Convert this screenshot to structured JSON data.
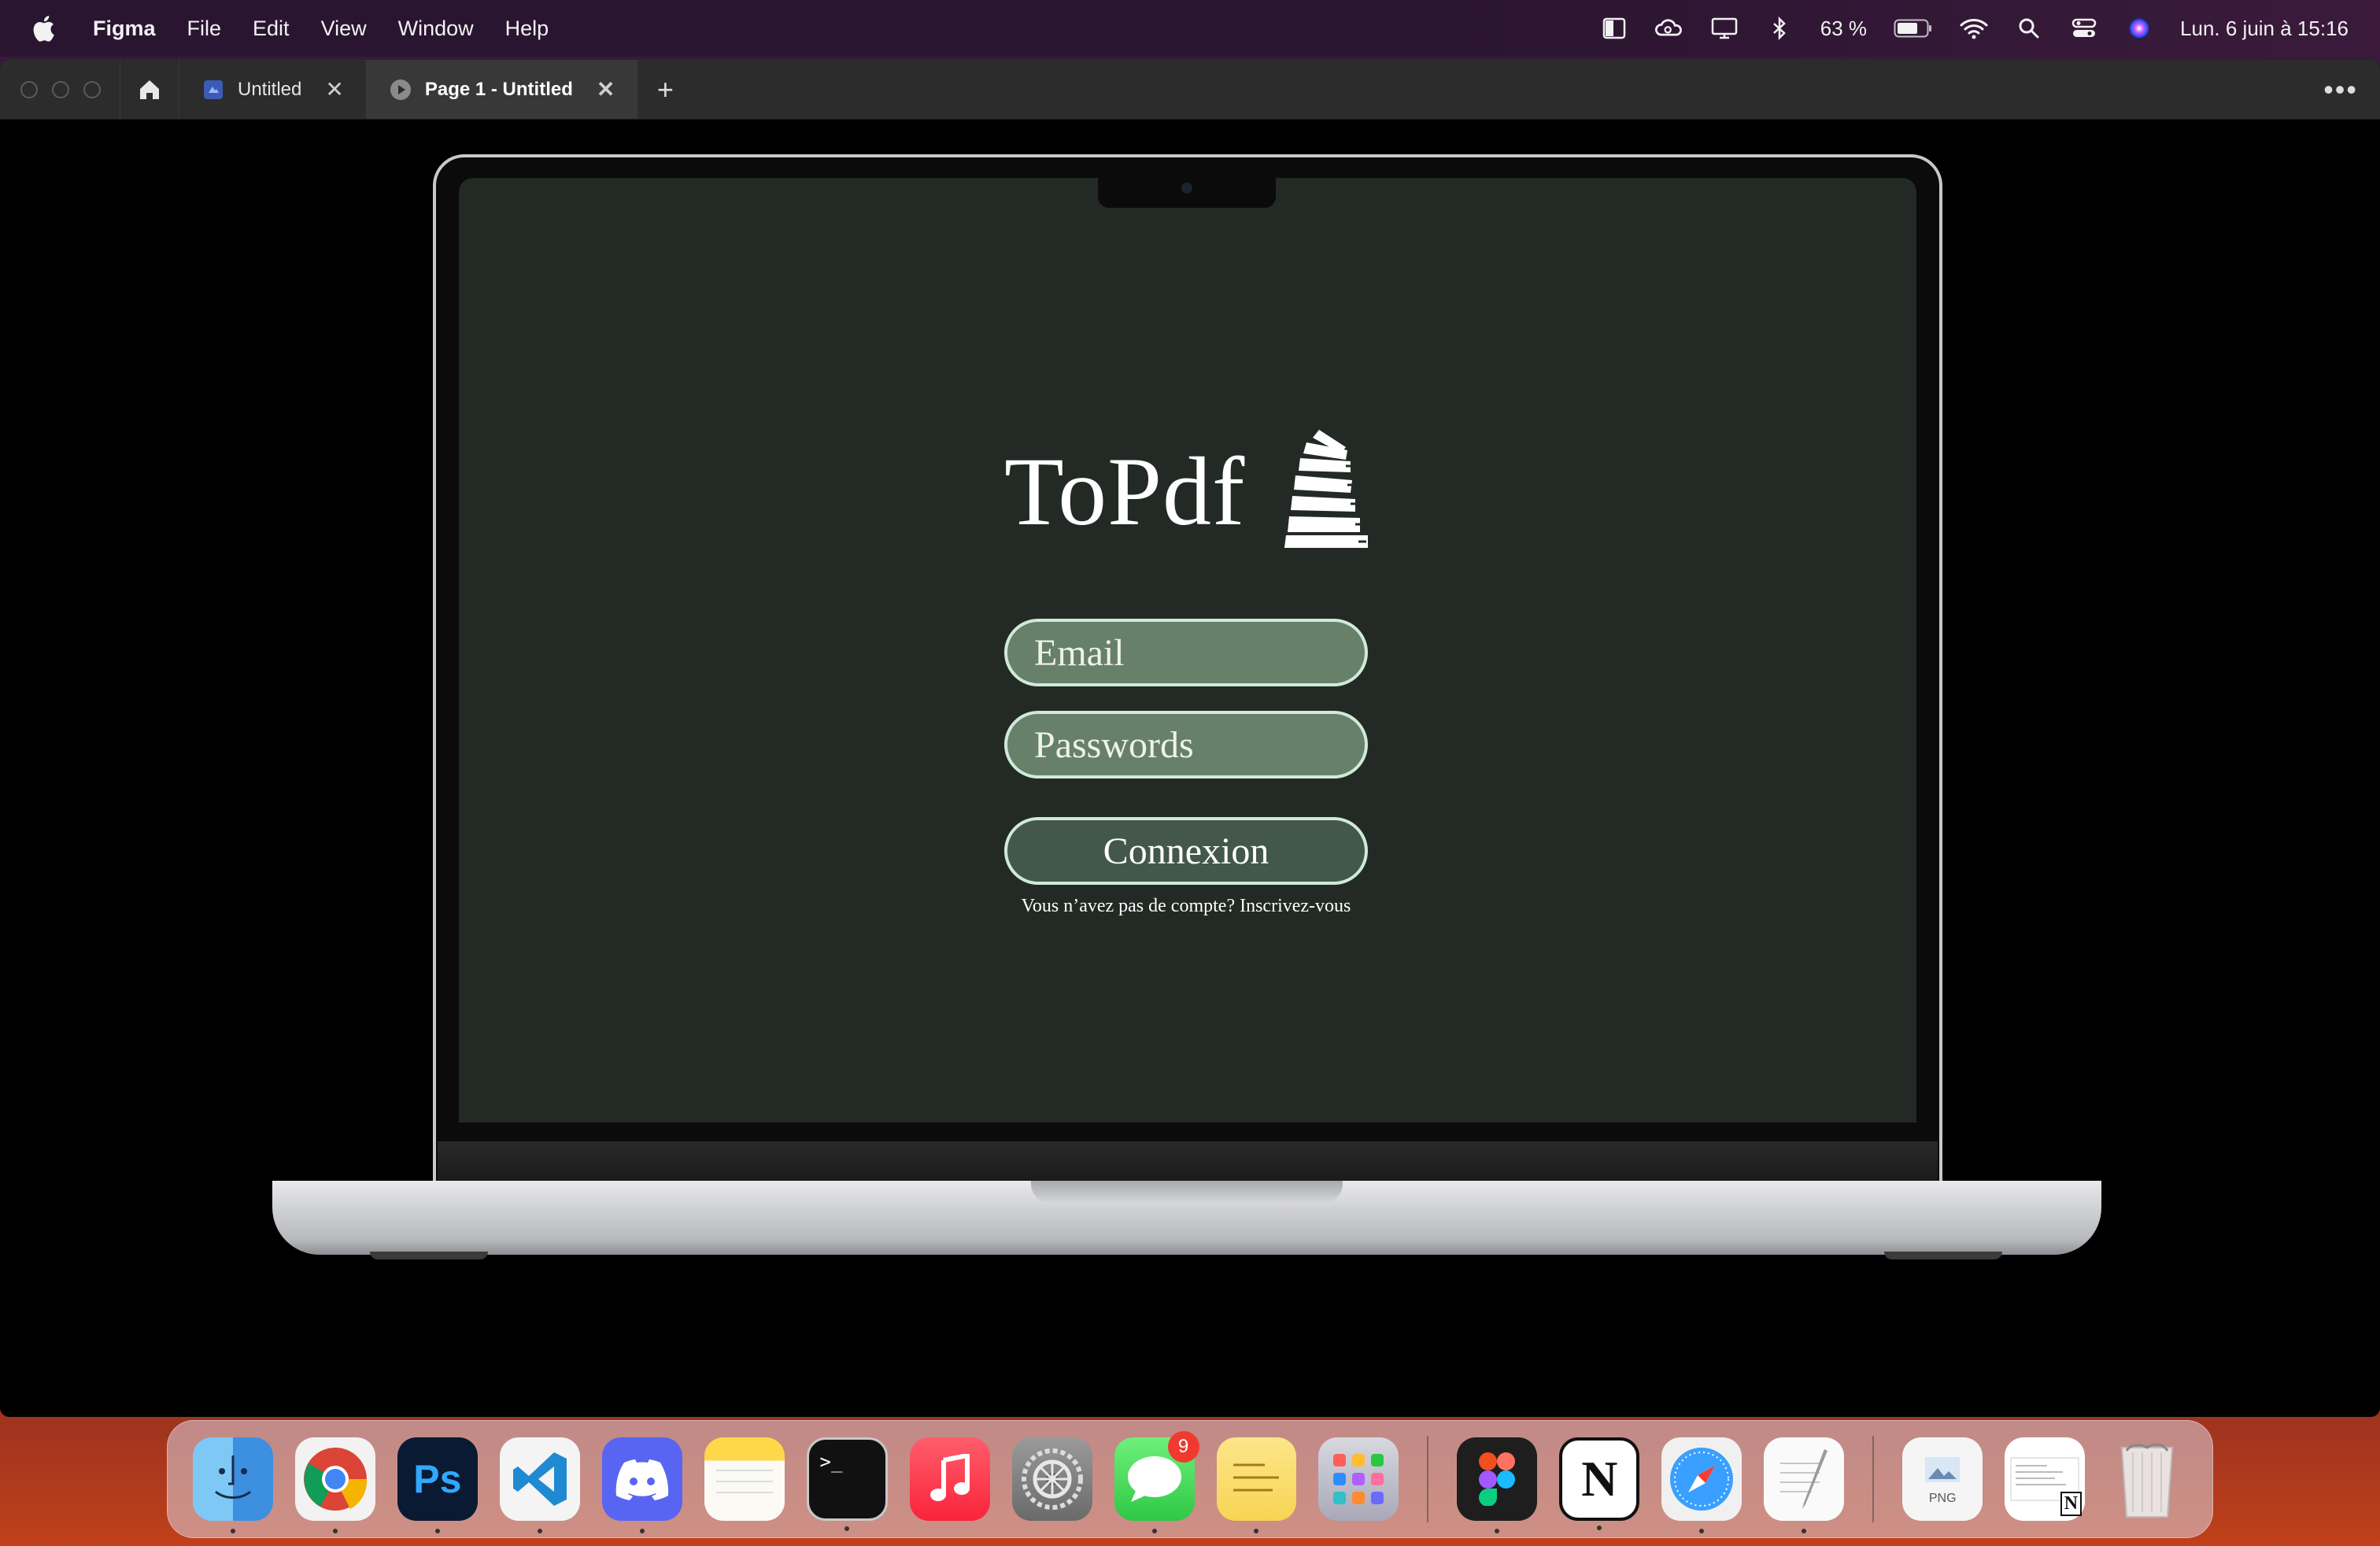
{
  "menubar": {
    "app_name": "Figma",
    "menus": [
      "File",
      "Edit",
      "View",
      "Window",
      "Help"
    ],
    "battery": "63 %",
    "clock": "Lun. 6 juin à  15:16"
  },
  "window": {
    "tabs": [
      {
        "label": "Untitled",
        "icon": "design-file-icon",
        "active": false
      },
      {
        "label": "Page 1 - Untitled",
        "icon": "play-icon",
        "active": true
      }
    ],
    "close_glyph": "✕",
    "add_tab_glyph": "+",
    "more_glyph": "•••"
  },
  "prototype": {
    "brand_title": "ToPdf",
    "email_placeholder": "Email",
    "password_placeholder": "Passwords",
    "connect_label": "Connexion",
    "signup_text": "Vous n’avez pas de compte? Inscrivez-vous",
    "colors": {
      "screen_bg": "#232a25",
      "field_bg": "#67806a",
      "button_bg": "#43584b",
      "field_border": "#cfead8"
    }
  },
  "dock": {
    "apps": [
      {
        "name": "Finder",
        "icon": "finder-icon",
        "running": true
      },
      {
        "name": "Chrome",
        "icon": "chrome-icon",
        "running": true
      },
      {
        "name": "Photoshop",
        "icon": "photoshop-icon",
        "label": "Ps",
        "running": true
      },
      {
        "name": "VS Code",
        "icon": "vscode-icon",
        "running": true
      },
      {
        "name": "Discord",
        "icon": "discord-icon",
        "running": true
      },
      {
        "name": "Notes",
        "icon": "notes-icon",
        "running": false
      },
      {
        "name": "Terminal",
        "icon": "terminal-icon",
        "label": ">_",
        "running": true
      },
      {
        "name": "Music",
        "icon": "music-icon",
        "running": false
      },
      {
        "name": "System Settings",
        "icon": "settings-icon",
        "running": false
      },
      {
        "name": "Messages",
        "icon": "messages-icon",
        "badge": "9",
        "running": true
      },
      {
        "name": "Stickies",
        "icon": "stickies-icon",
        "running": true
      },
      {
        "name": "Launchpad",
        "icon": "launchpad-icon",
        "running": false
      },
      {
        "name": "Figma",
        "icon": "figma-icon",
        "running": true
      },
      {
        "name": "Notion",
        "icon": "notion-icon",
        "label": "N",
        "running": true
      },
      {
        "name": "Safari",
        "icon": "safari-icon",
        "running": true
      },
      {
        "name": "TextEdit",
        "icon": "textedit-icon",
        "running": true
      }
    ],
    "recent": [
      {
        "name": "PNG document",
        "icon": "png-file-icon",
        "label": "PNG"
      },
      {
        "name": "Notion document",
        "icon": "notion-doc-icon",
        "label": "N"
      }
    ],
    "trash": {
      "name": "Trash",
      "icon": "trash-icon"
    }
  }
}
